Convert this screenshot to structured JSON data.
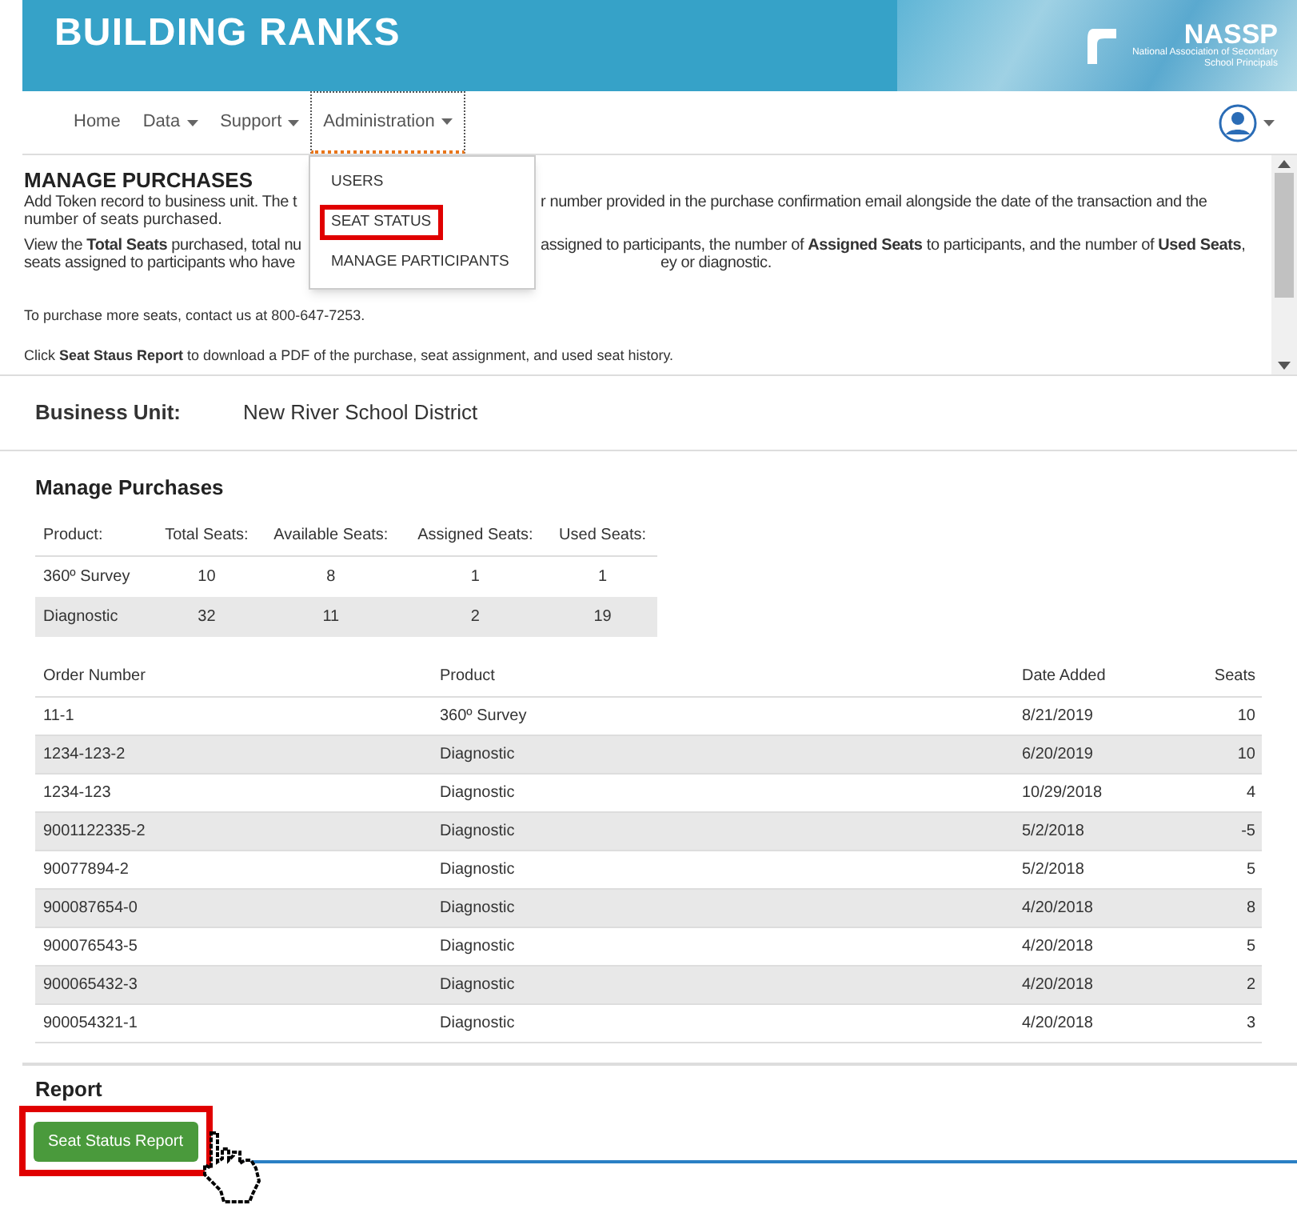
{
  "header": {
    "title": "BUILDING RANKS",
    "logo_name": "NASSP",
    "logo_subtitle": "National Association of Secondary School Principals"
  },
  "nav": [
    {
      "label": "Home",
      "dropdown": false,
      "selected": false
    },
    {
      "label": "Data",
      "dropdown": true,
      "selected": false
    },
    {
      "label": "Support",
      "dropdown": true,
      "selected": false
    },
    {
      "label": "Administration",
      "dropdown": true,
      "selected": true
    }
  ],
  "menu": [
    {
      "label": "USERS",
      "highlighted": false
    },
    {
      "label": "SEAT STATUS",
      "highlighted": true
    },
    {
      "label": "MANAGE PARTICIPANTS",
      "highlighted": false
    }
  ],
  "info": {
    "title": "MANAGE PURCHASES",
    "p1_left": "Add Token record to business unit. The t",
    "p1_right": "r number provided in the purchase confirmation email alongside the date of the transaction and the",
    "p1_line2": "number of seats purchased.",
    "p2_left": "View the **Total Seats** purchased, total nu",
    "p2_right": "assigned to participants, the number of **Assigned Seats** to participants, and the number of **Used Seats**,",
    "p2_line2_left": "seats assigned to participants who have",
    "p2_line2_right": "ey or diagnostic.",
    "contact": "To purchase more seats, contact us at 800-647-7253.",
    "click": "Click **Seat Staus Report** to download a PDF of the purchase, seat assignment, and used seat history."
  },
  "business_unit": {
    "label": "Business Unit:",
    "value": "New River School District"
  },
  "summary": {
    "title": "Manage Purchases",
    "columns": [
      "Product:",
      "Total Seats:",
      "Available Seats:",
      "Assigned Seats:",
      "Used Seats:"
    ],
    "rows": [
      [
        "360º Survey",
        "10",
        "8",
        "1",
        "1"
      ],
      [
        "Diagnostic",
        "32",
        "11",
        "2",
        "19"
      ]
    ]
  },
  "orders": {
    "columns": [
      "Order Number",
      "Product",
      "Date Added",
      "Seats"
    ],
    "rows": [
      [
        "11-1",
        "360º Survey",
        "8/21/2019",
        "10"
      ],
      [
        "1234-123-2",
        "Diagnostic",
        "6/20/2019",
        "10"
      ],
      [
        "1234-123",
        "Diagnostic",
        "10/29/2018",
        "4"
      ],
      [
        "9001122335-2",
        "Diagnostic",
        "5/2/2018",
        "-5"
      ],
      [
        "90077894-2",
        "Diagnostic",
        "5/2/2018",
        "5"
      ],
      [
        "900087654-0",
        "Diagnostic",
        "4/20/2018",
        "8"
      ],
      [
        "900076543-5",
        "Diagnostic",
        "4/20/2018",
        "5"
      ],
      [
        "900065432-3",
        "Diagnostic",
        "4/20/2018",
        "2"
      ],
      [
        "900054321-1",
        "Diagnostic",
        "4/20/2018",
        "3"
      ]
    ]
  },
  "report": {
    "title": "Report",
    "button": "Seat Status Report",
    "highlighted": true
  }
}
